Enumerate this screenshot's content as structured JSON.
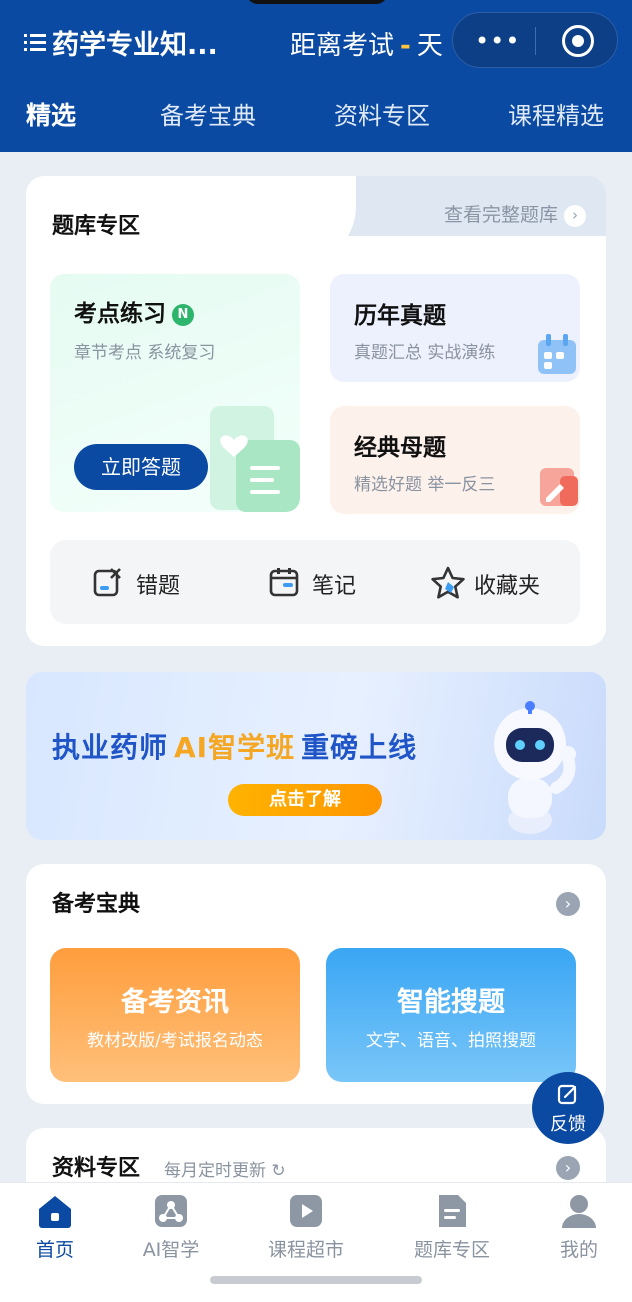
{
  "header": {
    "app_title": "药学专业知...",
    "countdown_prefix": "距离考试",
    "countdown_value": "-",
    "countdown_unit": "天",
    "capsule_more": "•••",
    "tabs": [
      {
        "label": "精选",
        "active": true
      },
      {
        "label": "备考宝典",
        "active": false
      },
      {
        "label": "资料专区",
        "active": false
      },
      {
        "label": "课程精选",
        "active": false
      }
    ]
  },
  "question_bank": {
    "title": "题库专区",
    "view_all": "查看完整题库",
    "practice": {
      "title": "考点练习",
      "badge": "N",
      "subtitle": "章节考点 系统复习",
      "button": "立即答题"
    },
    "past_exams": {
      "title": "历年真题",
      "subtitle": "真题汇总 实战演练"
    },
    "classic": {
      "title": "经典母题",
      "subtitle": "精选好题 举一反三"
    },
    "tools": [
      {
        "label": "错题",
        "icon": "wrong-questions-icon"
      },
      {
        "label": "笔记",
        "icon": "notes-icon"
      },
      {
        "label": "收藏夹",
        "icon": "star-icon"
      }
    ]
  },
  "banner": {
    "text_before": "执业药师",
    "text_ai": "AI智学班",
    "text_after": "重磅上线",
    "button": "点击了解"
  },
  "study_guide": {
    "title": "备考宝典",
    "tiles": [
      {
        "title": "备考资讯",
        "subtitle": "教材改版/考试报名动态"
      },
      {
        "title": "智能搜题",
        "subtitle": "文字、语音、拍照搜题"
      }
    ]
  },
  "feedback": {
    "label": "反馈"
  },
  "resources": {
    "title": "资料专区",
    "note": "每月定时更新"
  },
  "bottom_nav": [
    {
      "label": "首页",
      "icon": "home-icon",
      "active": true
    },
    {
      "label": "AI智学",
      "icon": "ai-study-icon",
      "active": false
    },
    {
      "label": "课程超市",
      "icon": "play-icon",
      "active": false
    },
    {
      "label": "题库专区",
      "icon": "document-icon",
      "active": false
    },
    {
      "label": "我的",
      "icon": "user-icon",
      "active": false
    }
  ],
  "colors": {
    "primary": "#0b4aa2",
    "accent_orange": "#ff9d3d",
    "accent_blue": "#3aa6f4",
    "new_green": "#2db56c"
  }
}
